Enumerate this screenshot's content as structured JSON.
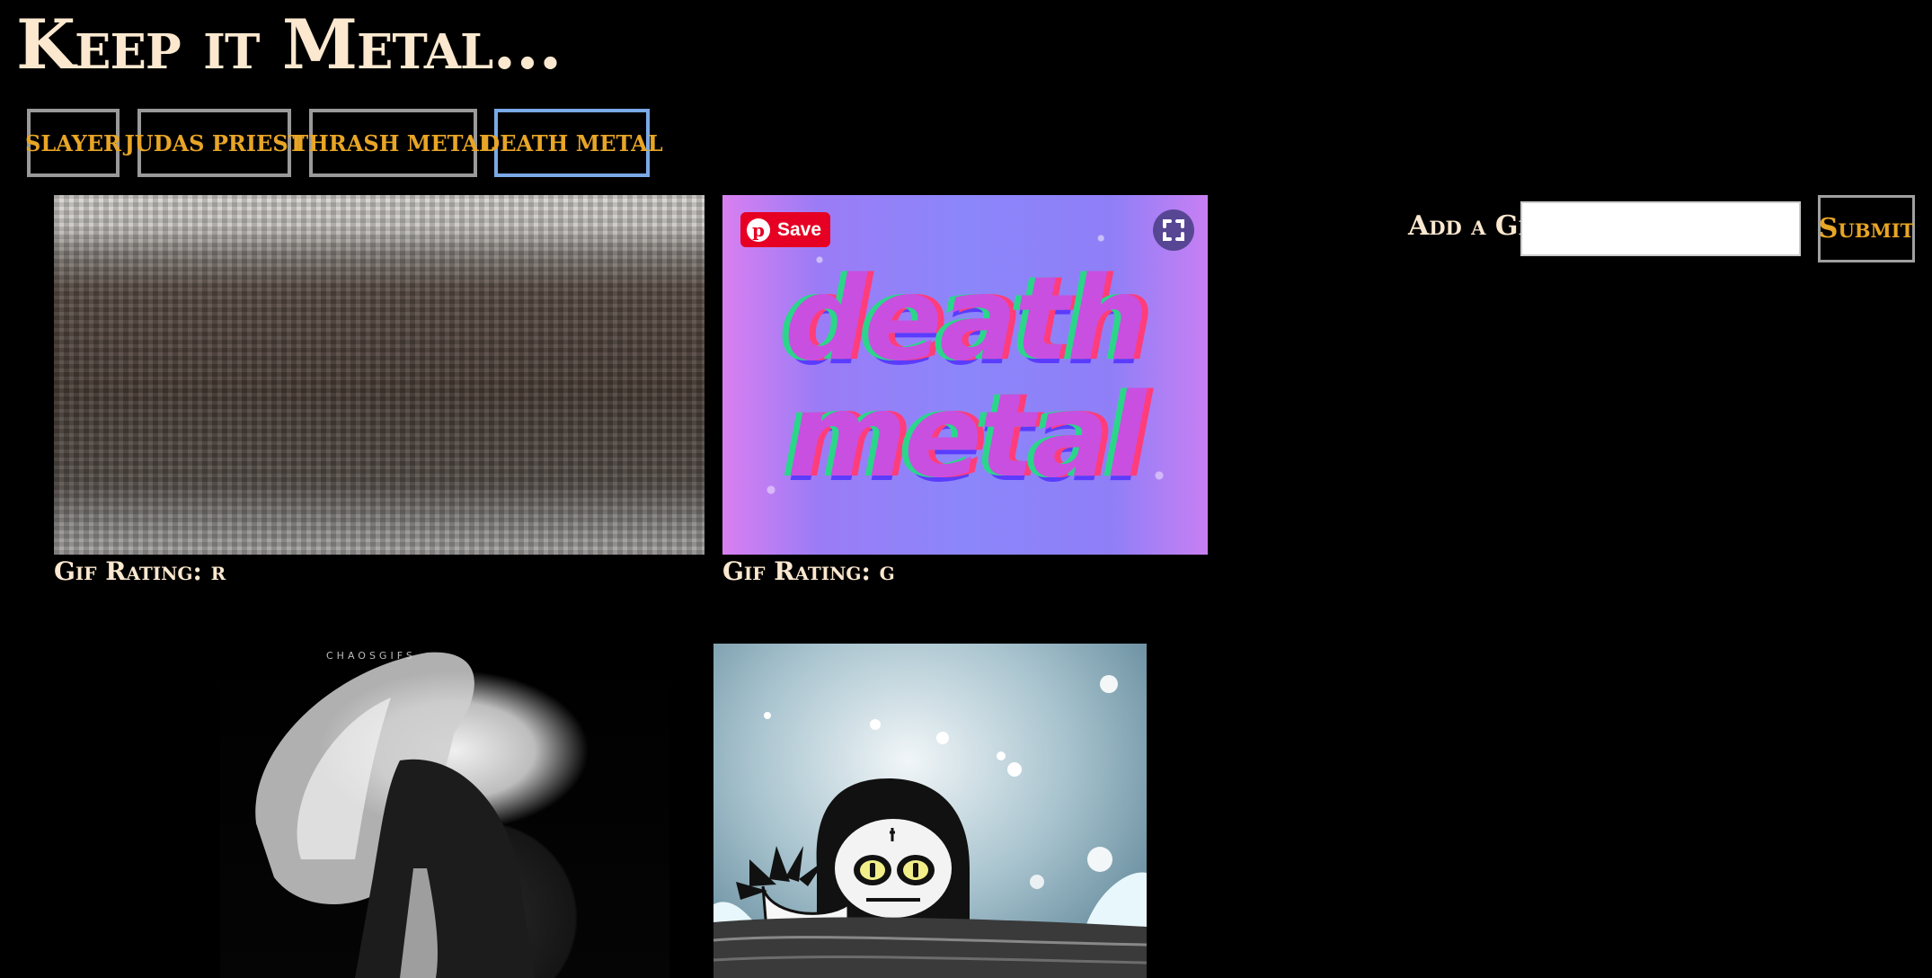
{
  "header": {
    "title": "Keep it Metal..."
  },
  "topics": [
    {
      "label": "slayer",
      "active": false
    },
    {
      "label": "judas priest",
      "active": false
    },
    {
      "label": "thrash metal",
      "active": false
    },
    {
      "label": "death metal",
      "active": true
    }
  ],
  "gifs": [
    {
      "rating_label": "Gif Rating: r"
    },
    {
      "rating_label": "Gif Rating: g",
      "image_text_line1": "death",
      "image_text_line2": "metal",
      "pinterest_save_label": "Save"
    },
    {
      "watermark": "CHAOSGIFS"
    },
    {}
  ],
  "add_gif": {
    "label": "Add a Gif",
    "input_value": "",
    "submit_label": "Submit"
  },
  "colors": {
    "background": "#000000",
    "title_text": "#fbe8cf",
    "button_text": "#e8a526",
    "button_border": "#9a9a9a",
    "active_button_border": "#7aa9e6",
    "pinterest_red": "#e60023"
  },
  "icons": [
    "pinterest-logo-icon",
    "expand-icon"
  ]
}
